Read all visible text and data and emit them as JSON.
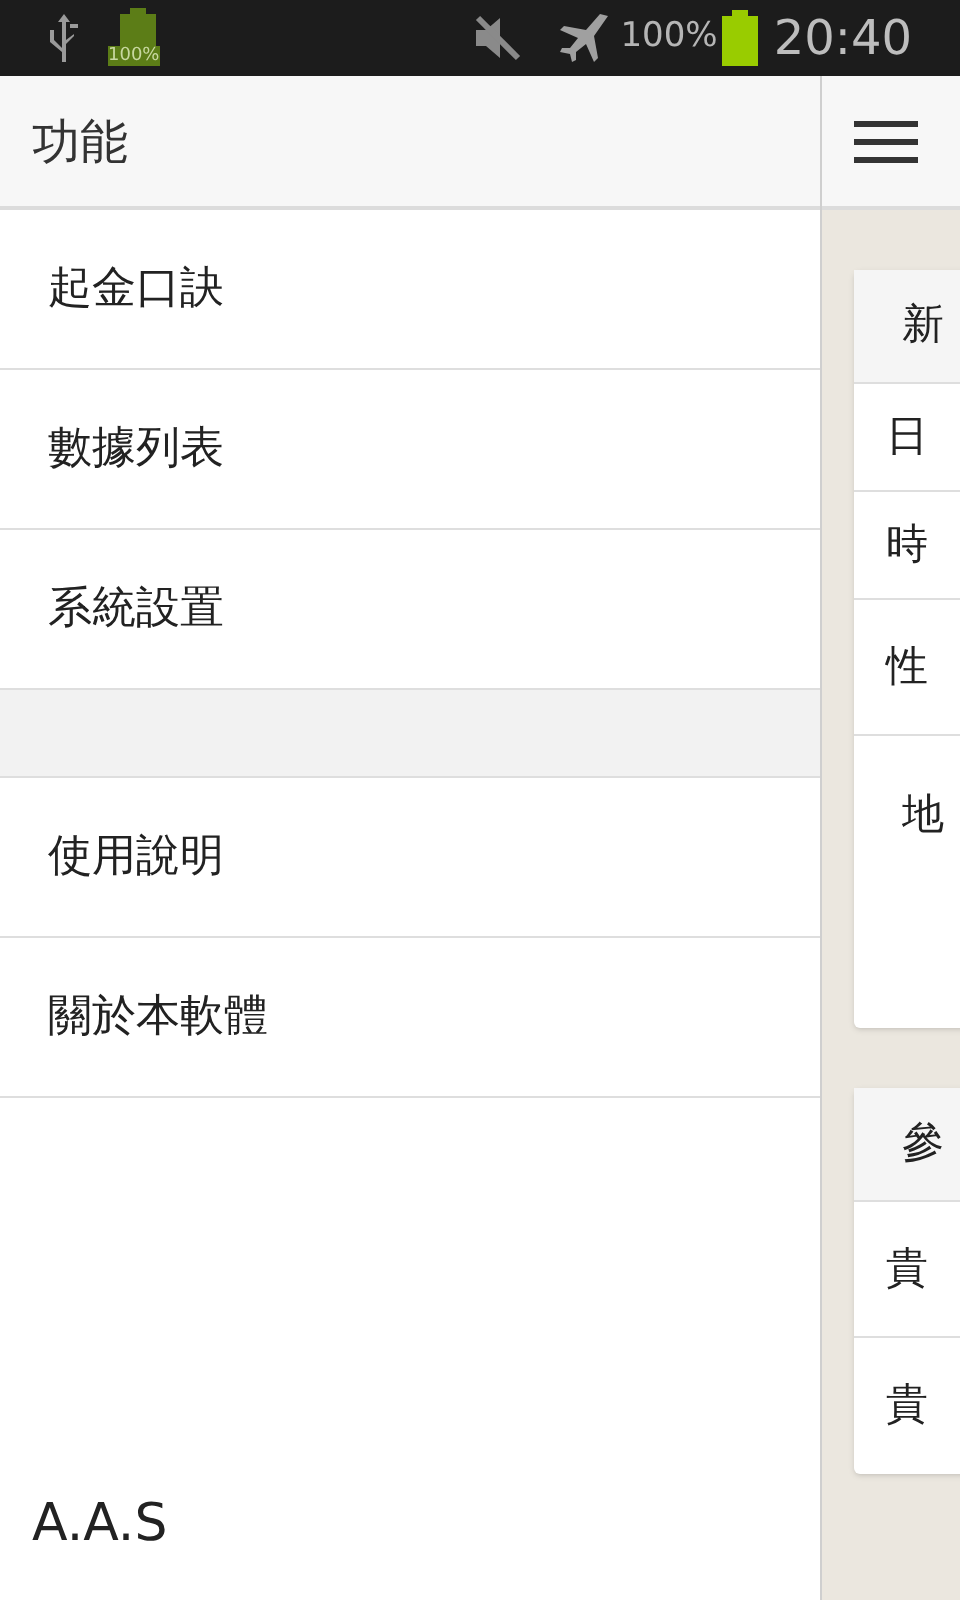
{
  "status_bar": {
    "battery_label": "100%",
    "battery_percent": "100%",
    "time": "20:40"
  },
  "drawer": {
    "title": "功能",
    "items": [
      {
        "kind": "item",
        "label": "起金口訣"
      },
      {
        "kind": "item",
        "label": "數據列表"
      },
      {
        "kind": "item",
        "label": "系統設置"
      },
      {
        "kind": "spacer"
      },
      {
        "kind": "item",
        "label": "使用說明"
      },
      {
        "kind": "item",
        "label": "關於本軟體"
      }
    ],
    "footer": "A.A.S"
  },
  "content": {
    "cards": [
      {
        "header": "新",
        "rows": [
          {
            "kind": "short",
            "label": "日"
          },
          {
            "kind": "short",
            "label": "時"
          },
          {
            "kind": "medium",
            "label": "性"
          },
          {
            "kind": "tall",
            "label": "地"
          }
        ]
      },
      {
        "header": "參",
        "rows": [
          {
            "kind": "medium",
            "label": "貴"
          },
          {
            "kind": "medium",
            "label": "貴"
          }
        ]
      }
    ]
  }
}
